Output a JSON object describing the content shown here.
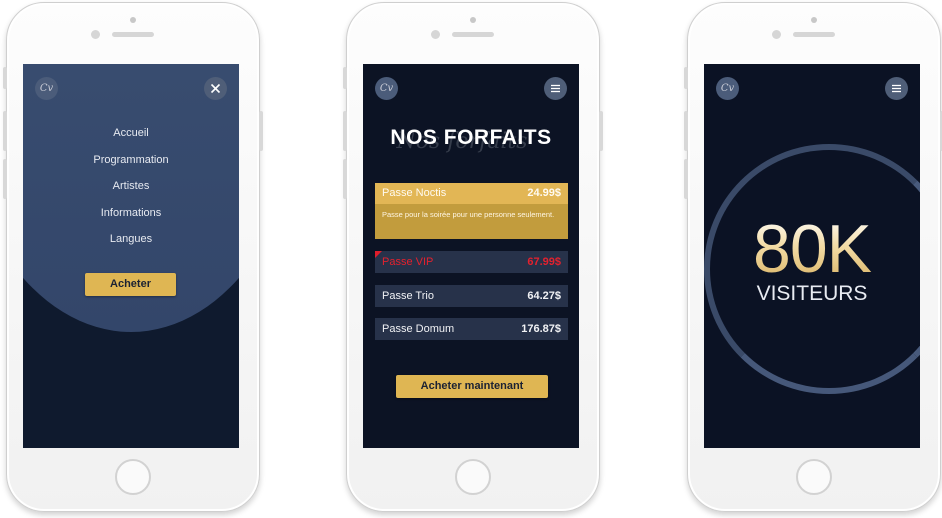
{
  "screen1": {
    "logo_text": "Cv",
    "close_icon": "close-icon",
    "menu": [
      "Accueil",
      "Programmation",
      "Artistes",
      "Informations",
      "Langues"
    ],
    "buy_label": "Acheter",
    "colors": {
      "menu_bg": "#3d5274",
      "gold": "#dfb653"
    }
  },
  "screen2": {
    "logo_text": "Cv",
    "menu_icon": "hamburger-menu-icon",
    "title": "NOS FORFAITS",
    "title_script": "Nos forfaits",
    "plans": [
      {
        "name": "Passe Noctis",
        "price": "24.99$",
        "description": "Passe pour la soirée pour une personne seulement.",
        "state": "selected"
      },
      {
        "name": "Passe VIP",
        "price": "67.99$",
        "state": "highlight"
      },
      {
        "name": "Passe Trio",
        "price": "64.27$"
      },
      {
        "name": "Passe Domum",
        "price": "176.87$"
      }
    ],
    "buy_label": "Acheter maintenant",
    "colors": {
      "accent": "#e2b655",
      "vip": "#e3212e"
    }
  },
  "screen3": {
    "logo_text": "Cv",
    "menu_icon": "hamburger-menu-icon",
    "big_number": "80K",
    "label": "VISITEURS"
  }
}
